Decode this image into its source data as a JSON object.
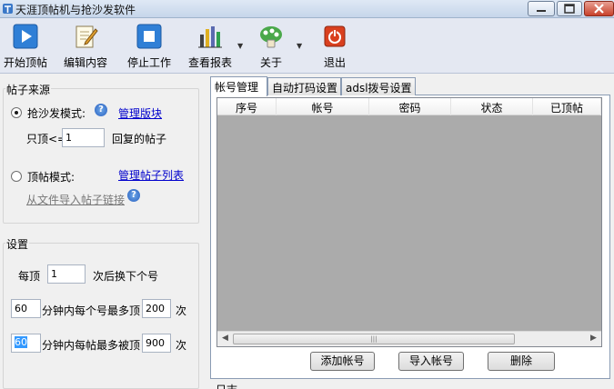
{
  "window": {
    "title": "天涯顶帖机与抢沙发软件"
  },
  "toolbar": {
    "items": [
      {
        "label": "开始顶帖",
        "icon": "play-icon"
      },
      {
        "label": "编辑内容",
        "icon": "edit-icon"
      },
      {
        "label": "停止工作",
        "icon": "stop-icon"
      },
      {
        "label": "查看报表",
        "icon": "report-icon"
      },
      {
        "label": "关于",
        "icon": "about-icon"
      },
      {
        "label": "退出",
        "icon": "exit-icon"
      }
    ]
  },
  "source_group": {
    "title": "帖子来源",
    "sofa_mode_label": "抢沙发模式:",
    "manage_board_link": "管理版块",
    "only_top_label": "只顶<=",
    "only_top_value": "1",
    "reply_post_label": "回复的帖子",
    "top_mode_label": "顶帖模式:",
    "manage_post_list_link": "管理帖子列表",
    "import_link": "从文件导入帖子链接"
  },
  "settings_group": {
    "title": "设置",
    "per_top_label": "每顶",
    "per_top_value": "1",
    "switch_account_label": "次后换下个号",
    "minutes_a_value": "60",
    "max_per_account_label": "分钟内每个号最多顶",
    "max_per_account_value": "200",
    "times_a_label": "次",
    "minutes_b_value": "60",
    "max_per_post_label": "分钟内每帖最多被顶",
    "max_per_post_value": "900",
    "times_b_label": "次"
  },
  "tabs": [
    {
      "label": "帐号管理",
      "active": true
    },
    {
      "label": "自动打码设置",
      "active": false
    },
    {
      "label": "adsl拨号设置",
      "active": false
    }
  ],
  "account_table": {
    "columns": [
      "序号",
      "帐号",
      "密码",
      "状态",
      "已顶帖"
    ]
  },
  "buttons": {
    "add_account": "添加帐号",
    "import_account": "导入帐号",
    "delete": "删除"
  },
  "log": {
    "label": "日志"
  }
}
